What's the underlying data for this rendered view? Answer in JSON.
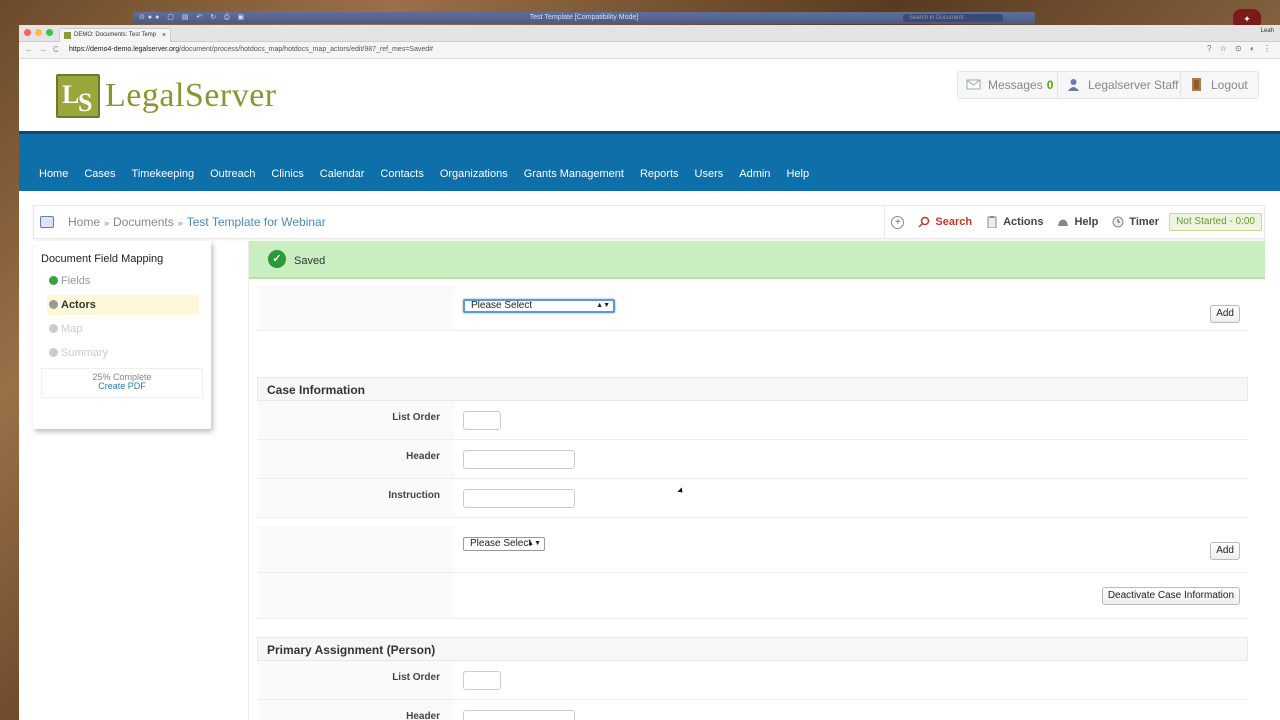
{
  "mac": {
    "title": "Test Template [Compatibility Mode]",
    "search_placeholder": "Search in Document"
  },
  "browser": {
    "tab_title": "DEMO: Documents: Test Temp",
    "user": "Leah",
    "url_host": "https://demo4-demo.legalserver.org",
    "url_path": "/document/process/hotdocs_map/hotdocs_map_actors/edit/987_ref_mes=Saved#"
  },
  "header": {
    "logo_text": "LegalServer",
    "messages_label": "Messages",
    "messages_count": "0",
    "staff_label": "Legalserver Staff",
    "logout_label": "Logout"
  },
  "nav": {
    "items": [
      "Home",
      "Cases",
      "Timekeeping",
      "Outreach",
      "Clinics",
      "Calendar",
      "Contacts",
      "Organizations",
      "Grants Management",
      "Reports",
      "Users",
      "Admin",
      "Help"
    ]
  },
  "breadcrumb": {
    "home": "Home",
    "sep": "»",
    "documents": "Documents",
    "current": "Test Template for Webinar"
  },
  "toolbar": {
    "search": "Search",
    "actions": "Actions",
    "help": "Help",
    "timer": "Timer",
    "status": "Not Started - 0:00"
  },
  "sidebar": {
    "title": "Document Field Mapping",
    "items": [
      "Fields",
      "Actors",
      "Map",
      "Summary"
    ],
    "progress": "25% Complete",
    "create_pdf": "Create PDF"
  },
  "alert": {
    "text": "Saved"
  },
  "form": {
    "top_select": "Please Select",
    "add": "Add",
    "case_info_title": "Case Information",
    "list_order": "List Order",
    "header": "Header",
    "instruction": "Instruction",
    "select2": "Please Select",
    "deactivate": "Deactivate Case Information",
    "primary_title": "Primary Assignment (Person)"
  },
  "colors": {
    "nav_bg": "#0f6fa8",
    "brand": "#8a9634",
    "saved_bg": "#c9eec0",
    "search": "#c0392b"
  }
}
